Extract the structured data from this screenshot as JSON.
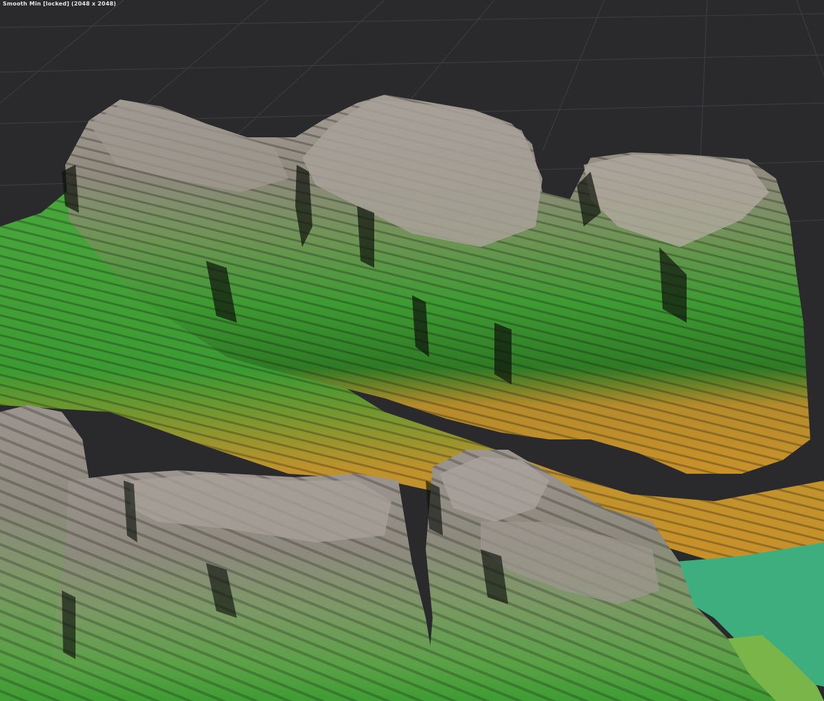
{
  "viewport": {
    "title": "Smooth Min [locked] (2048 x 2048)",
    "background_color": "#2a2a2d",
    "grid_color": "#3a3a3e"
  },
  "terrain": {
    "colors": {
      "rock": "#8a837d",
      "rock_light": "#a39c95",
      "grass": "#3f9c33",
      "grass_dark": "#1f4f1a",
      "sand": "#c8912a",
      "water": "#3fae7e",
      "shadow": "#0e120c"
    }
  }
}
